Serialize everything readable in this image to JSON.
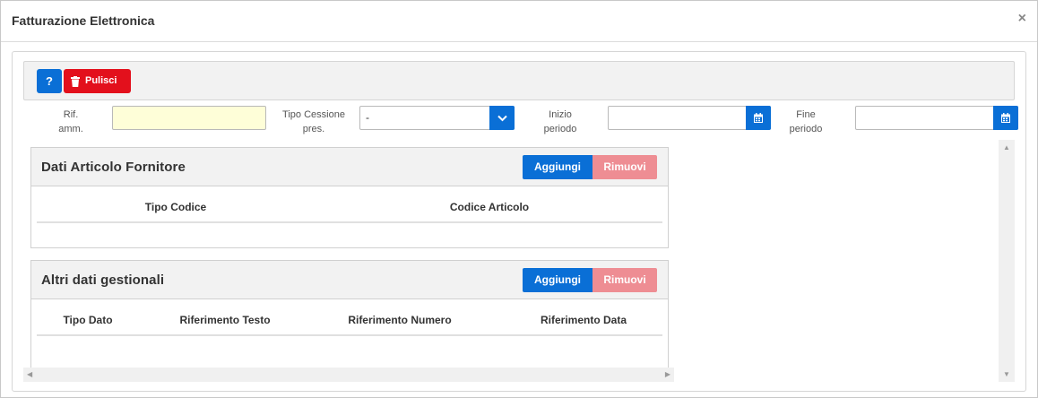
{
  "dialog": {
    "title": "Fatturazione Elettronica",
    "close_glyph": "×"
  },
  "toolbar": {
    "help_label": "?",
    "clear_label": "Pulisci"
  },
  "filters": {
    "rif_amm_label_1": "Rif.",
    "rif_amm_label_2": "amm.",
    "rif_amm_value": "",
    "tipo_cessione_label_1": "Tipo Cessione",
    "tipo_cessione_label_2": "pres.",
    "tipo_cessione_value": "-",
    "inizio_label_1": "Inizio",
    "inizio_label_2": "periodo",
    "inizio_value": "",
    "fine_label_1": "Fine",
    "fine_label_2": "periodo",
    "fine_value": ""
  },
  "panel_articolo": {
    "title": "Dati Articolo Fornitore",
    "add_label": "Aggiungi",
    "remove_label": "Rimuovi",
    "columns": [
      "Tipo Codice",
      "Codice Articolo"
    ]
  },
  "panel_gestionali": {
    "title": "Altri dati gestionali",
    "add_label": "Aggiungi",
    "remove_label": "Rimuovi",
    "columns": [
      "Tipo Dato",
      "Riferimento Testo",
      "Riferimento Numero",
      "Riferimento Data"
    ]
  },
  "colors": {
    "primary": "#0a6fd6",
    "danger": "#e3101c",
    "danger_disabled": "#ee8d93",
    "highlight_input": "#fefed8"
  },
  "icons": {
    "close": "close-icon",
    "trash": "trash-icon",
    "chevron": "chevron-down-icon",
    "calendar": "calendar-icon"
  }
}
